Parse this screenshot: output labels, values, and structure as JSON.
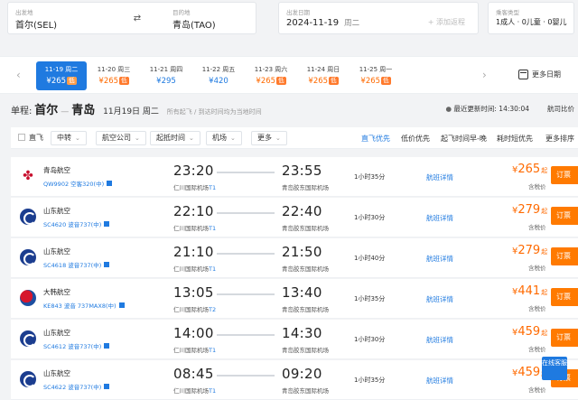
{
  "search": {
    "from_label": "出发地",
    "from_value": "首尔(SEL)",
    "to_label": "目的地",
    "to_value": "青岛(TAO)",
    "date_label": "出发日期",
    "date_value": "2024-11-19",
    "date_week": "周二",
    "add_return": "+ 添加返程",
    "cabin_label": "乘客类型",
    "cabin_value": "1成人 · 0儿童 · 0婴儿"
  },
  "date_strip": {
    "prev": "‹",
    "next": "›",
    "items": [
      {
        "date": "11-19 周二",
        "price": "¥265",
        "low": "低",
        "active": true
      },
      {
        "date": "11-20 周三",
        "price": "¥265",
        "low": "低"
      },
      {
        "date": "11-21 周四",
        "price": "¥295",
        "low": ""
      },
      {
        "date": "11-22 周五",
        "price": "¥420",
        "low": ""
      },
      {
        "date": "11-23 周六",
        "price": "¥265",
        "low": "低"
      },
      {
        "date": "11-24 周日",
        "price": "¥265",
        "low": "低"
      },
      {
        "date": "11-25 周一",
        "price": "¥265",
        "low": "低"
      }
    ],
    "more_dates": "更多日期"
  },
  "route": {
    "one_way": "单程:",
    "from_city": "首尔",
    "dash": "—",
    "to_city": "青岛",
    "date": "11月19日 周二",
    "note": "所有起飞 / 到达时间均为当地时间",
    "updated": "最近更新时间: 14:30:04",
    "tip": "航司比价"
  },
  "filters": {
    "direct": "直飞",
    "buttons": [
      "中转",
      "航空公司",
      "起抵时间",
      "机场",
      "更多"
    ],
    "sorts": [
      "直飞优先",
      "低价优先",
      "起飞时间早-晚",
      "耗时短优先",
      "更多排序"
    ]
  },
  "flights": [
    {
      "airline": "青岛航空",
      "flight": "QW9902 空客320(中)",
      "dep": "23:20",
      "dep_airport": "仁川国际机场",
      "dep_term": "T1",
      "arr": "23:55",
      "arr_airport": "青岛胶东国际机场",
      "duration": "1小时35分",
      "detail": "航班详情",
      "price": "265",
      "tax": "含税价",
      "book": "订票"
    },
    {
      "airline": "山东航空",
      "flight": "SC4620 波音737(中)",
      "dep": "22:10",
      "dep_airport": "仁川国际机场",
      "dep_term": "T1",
      "arr": "22:40",
      "arr_airport": "青岛胶东国际机场",
      "duration": "1小时30分",
      "detail": "航班详情",
      "price": "279",
      "tax": "含税价",
      "book": "订票"
    },
    {
      "airline": "山东航空",
      "flight": "SC4618 波音737(中)",
      "dep": "21:10",
      "dep_airport": "仁川国际机场",
      "dep_term": "T1",
      "arr": "21:50",
      "arr_airport": "青岛胶东国际机场",
      "duration": "1小时40分",
      "detail": "航班详情",
      "price": "279",
      "tax": "含税价",
      "book": "订票"
    },
    {
      "airline": "大韩航空",
      "flight": "KE843 波音 737MAX8(中)",
      "dep": "13:05",
      "dep_airport": "仁川国际机场",
      "dep_term": "T2",
      "arr": "13:40",
      "arr_airport": "青岛胶东国际机场",
      "duration": "1小时35分",
      "detail": "航班详情",
      "price": "441",
      "tax": "含税价",
      "book": "订票"
    },
    {
      "airline": "山东航空",
      "flight": "SC4612 波音737(中)",
      "dep": "14:00",
      "dep_airport": "仁川国际机场",
      "dep_term": "T1",
      "arr": "14:30",
      "arr_airport": "青岛胶东国际机场",
      "duration": "1小时30分",
      "detail": "航班详情",
      "price": "459",
      "tax": "含税价",
      "book": "订票"
    },
    {
      "airline": "山东航空",
      "flight": "SC4622 波音737(中)",
      "dep": "08:45",
      "dep_airport": "仁川国际机场",
      "dep_term": "T1",
      "arr": "09:20",
      "arr_airport": "青岛胶东国际机场",
      "duration": "1小时35分",
      "detail": "航班详情",
      "price": "459",
      "tax": "含税价",
      "book": "订票"
    }
  ],
  "currency": "¥",
  "from_suffix": "起",
  "service": "在线客服"
}
